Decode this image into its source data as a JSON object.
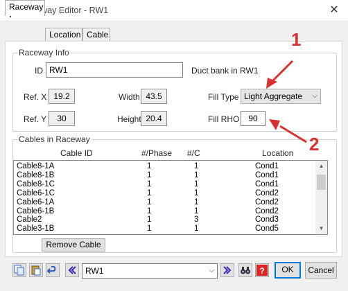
{
  "window": {
    "title": "Raceway Editor - RW1",
    "close_label": "✕"
  },
  "tabs": [
    {
      "label": "Raceway"
    },
    {
      "label": "Location"
    },
    {
      "label": "Cable"
    }
  ],
  "raceway_info": {
    "group_label": "Raceway Info",
    "id_label": "ID",
    "id_value": "RW1",
    "location_text": "Duct bank in RW1",
    "ref_x_label": "Ref. X",
    "ref_x_value": "19.2",
    "ref_y_label": "Ref. Y",
    "ref_y_value": "30",
    "width_label": "Width",
    "width_value": "43.5",
    "height_label": "Height",
    "height_value": "20.4",
    "fill_type_label": "Fill Type",
    "fill_type_value": "Light Aggregate",
    "fill_rho_label": "Fill RHO",
    "fill_rho_value": "90"
  },
  "cables": {
    "group_label": "Cables in Raceway",
    "columns": [
      "Cable ID",
      "#/Phase",
      "#/C",
      "Location"
    ],
    "rows": [
      [
        "Cable8-1A",
        "1",
        "1",
        "Cond1"
      ],
      [
        "Cable8-1B",
        "1",
        "1",
        "Cond1"
      ],
      [
        "Cable8-1C",
        "1",
        "1",
        "Cond1"
      ],
      [
        "Cable6-1C",
        "1",
        "1",
        "Cond2"
      ],
      [
        "Cable6-1A",
        "1",
        "1",
        "Cond2"
      ],
      [
        "Cable6-1B",
        "1",
        "1",
        "Cond2"
      ],
      [
        "Cable2",
        "1",
        "3",
        "Cond3"
      ],
      [
        "Cable3-1B",
        "1",
        "1",
        "Cond5"
      ]
    ],
    "remove_button": "Remove Cable"
  },
  "bottom": {
    "nav_value": "RW1",
    "ok_label": "OK",
    "cancel_label": "Cancel"
  },
  "annotations": [
    "1",
    "2"
  ],
  "colors": {
    "annotation": "#d93030",
    "focus_border": "#0078d7"
  }
}
